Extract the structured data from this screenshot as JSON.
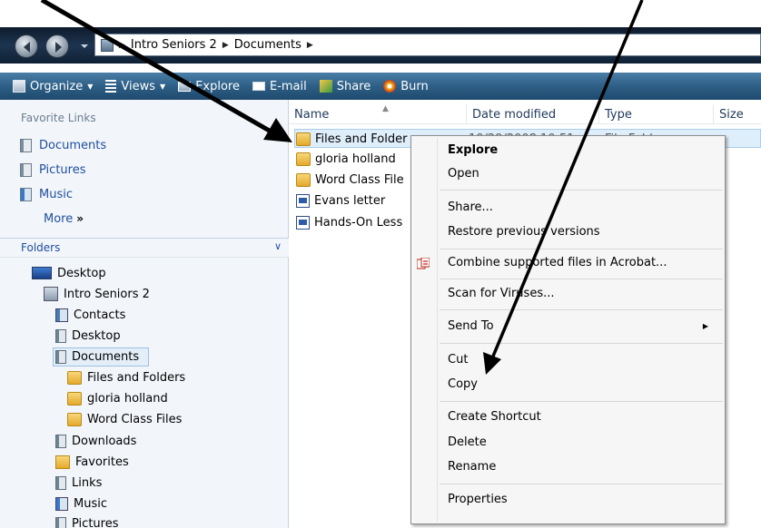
{
  "breadcrumb": {
    "items": [
      "Intro Seniors 2",
      "Documents"
    ]
  },
  "toolbar": {
    "items": [
      {
        "label": "Organize",
        "icon": "organize-icon",
        "dropdown": true
      },
      {
        "label": "Views",
        "icon": "views-icon",
        "dropdown": true
      },
      {
        "label": "Explore",
        "icon": "explore-icon"
      },
      {
        "label": "E-mail",
        "icon": "email-icon"
      },
      {
        "label": "Share",
        "icon": "share-icon"
      },
      {
        "label": "Burn",
        "icon": "burn-icon"
      }
    ]
  },
  "nav": {
    "favorites_title": "Favorite Links",
    "favorites": [
      "Documents",
      "Pictures",
      "Music"
    ],
    "more_label": "More",
    "more_chevron": "»",
    "folders_title": "Folders",
    "tree": [
      {
        "label": "Desktop",
        "icon": "desktop-icon"
      },
      {
        "label": "Intro Seniors 2",
        "icon": "user-folder-icon"
      },
      {
        "label": "Contacts",
        "icon": "contacts-icon"
      },
      {
        "label": "Desktop",
        "icon": "desktop-folder-icon"
      },
      {
        "label": "Documents",
        "icon": "documents-icon"
      },
      {
        "label": "Files and Folders",
        "icon": "folder-icon"
      },
      {
        "label": "gloria holland",
        "icon": "folder-icon"
      },
      {
        "label": "Word Class Files",
        "icon": "folder-icon"
      },
      {
        "label": "Downloads",
        "icon": "downloads-icon"
      },
      {
        "label": "Favorites",
        "icon": "favorites-icon"
      },
      {
        "label": "Links",
        "icon": "links-icon"
      },
      {
        "label": "Music",
        "icon": "music-icon"
      },
      {
        "label": "Pictures",
        "icon": "pictures-icon"
      }
    ]
  },
  "columns": [
    "Name",
    "Date modified",
    "Type",
    "Size"
  ],
  "files": [
    {
      "name": "Files and Folder",
      "icon": "folder-icon",
      "date": "10/29/2008 10:51",
      "type": "File Folder"
    },
    {
      "name": "gloria holland",
      "icon": "folder-icon"
    },
    {
      "name": "Word Class File",
      "icon": "folder-icon"
    },
    {
      "name": "Evans letter",
      "icon": "word-doc-icon"
    },
    {
      "name": "Hands-On Less",
      "icon": "word-doc-icon"
    }
  ],
  "context_menu": {
    "explore": "Explore",
    "open": "Open",
    "share": "Share...",
    "restore": "Restore previous versions",
    "acrobat": "Combine supported files in Acrobat...",
    "scan": "Scan for Viruses...",
    "send_to": "Send To",
    "send_to_arrow": "▶",
    "cut": "Cut",
    "copy": "Copy",
    "create_shortcut": "Create Shortcut",
    "delete": "Delete",
    "rename": "Rename",
    "properties": "Properties"
  },
  "colors": {
    "toolbar": "#2d5f86",
    "link": "#1f4fa0",
    "selection": "#dfeefb",
    "annotation_arrow": "#000000"
  }
}
